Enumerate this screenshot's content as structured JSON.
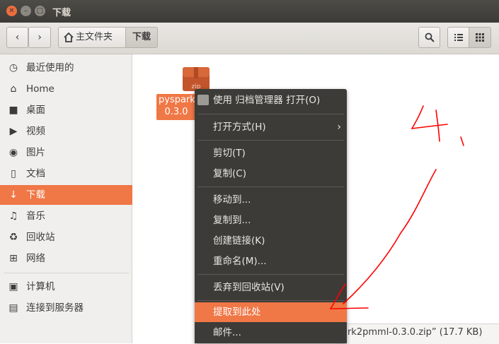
{
  "window": {
    "title": "下载"
  },
  "toolbar": {
    "back_icon": "‹",
    "forward_icon": "›",
    "breadcrumb": [
      {
        "label": "主文件夹",
        "icon": "home-icon"
      },
      {
        "label": "下载"
      }
    ],
    "search_icon": "search-icon",
    "list_view_icon": "list-view-icon",
    "grid_view_icon": "grid-view-icon"
  },
  "sidebar": {
    "items": [
      {
        "label": "最近使用的",
        "icon": "recent-icon",
        "glyph": "◷"
      },
      {
        "label": "Home",
        "icon": "home-icon",
        "glyph": "⌂"
      },
      {
        "label": "桌面",
        "icon": "desktop-folder-icon",
        "glyph": "■"
      },
      {
        "label": "视频",
        "icon": "video-icon",
        "glyph": "▶"
      },
      {
        "label": "图片",
        "icon": "camera-icon",
        "glyph": "◉"
      },
      {
        "label": "文档",
        "icon": "document-icon",
        "glyph": "▯"
      },
      {
        "label": "下载",
        "icon": "download-icon",
        "glyph": "↓",
        "active": true
      },
      {
        "label": "音乐",
        "icon": "music-icon",
        "glyph": "♫"
      },
      {
        "label": "回收站",
        "icon": "trash-icon",
        "glyph": "♻"
      },
      {
        "label": "网络",
        "icon": "network-icon",
        "glyph": "⊞"
      },
      {
        "label": "计算机",
        "icon": "computer-icon",
        "glyph": "▣"
      },
      {
        "label": "连接到服务器",
        "icon": "server-icon",
        "glyph": "▤"
      }
    ]
  },
  "file": {
    "icon_text": "zip",
    "label_line1": "pyspark",
    "label_line2": "0.3.0"
  },
  "status": {
    "text": "ark2pmml-0.3.0.zip” (17.7 KB)"
  },
  "context_menu": {
    "items": [
      {
        "label": "使用 归档管理器 打开(O)",
        "has_icon": true
      },
      {
        "label": "打开方式(H)",
        "submenu": true
      },
      {
        "label": "剪切(T)"
      },
      {
        "label": "复制(C)"
      },
      {
        "label": "移动到..."
      },
      {
        "label": "复制到..."
      },
      {
        "label": "创建链接(K)"
      },
      {
        "label": "重命名(M)..."
      },
      {
        "label": "丢弃到回收站(V)"
      },
      {
        "label": "提取到此处",
        "highlighted": true
      },
      {
        "label": "邮件..."
      }
    ]
  },
  "annotation": {
    "text": "4.",
    "color": "#ff0000"
  },
  "colors": {
    "accent": "#f07746",
    "menu_bg": "#3c3b37",
    "titlebar": "#3c3b37"
  }
}
